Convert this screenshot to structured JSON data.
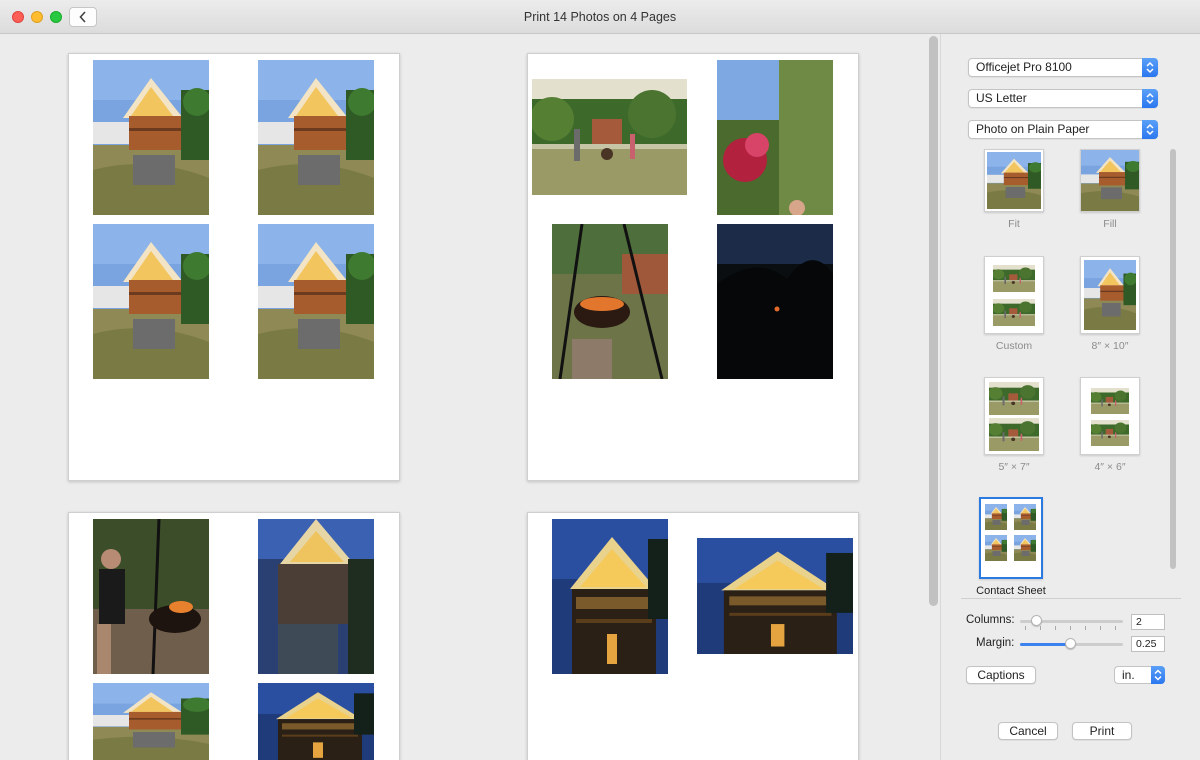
{
  "window": {
    "title": "Print 14 Photos on 4 Pages"
  },
  "settings": {
    "printer": "Officejet Pro 8100",
    "paper_size": "US Letter",
    "paper_type": "Photo on Plain Paper"
  },
  "layouts": [
    {
      "label": "Fit",
      "selected": false
    },
    {
      "label": "Fill",
      "selected": false
    },
    {
      "label": "Custom",
      "selected": false
    },
    {
      "label": "8″ × 10″",
      "selected": false
    },
    {
      "label": "5″ × 7″",
      "selected": false
    },
    {
      "label": "4″ × 6″",
      "selected": false
    },
    {
      "label": "Contact Sheet",
      "selected": true
    }
  ],
  "controls": {
    "columns_label": "Columns:",
    "columns_value": "2",
    "margin_label": "Margin:",
    "margin_value": "0.25",
    "captions_label": "Captions",
    "units_value": "in.",
    "cancel_label": "Cancel",
    "print_label": "Print"
  },
  "colors": {
    "accent": "#2b77ef",
    "sky_day": "#6f9fe0",
    "sky_night": "#1f3a78",
    "house": "#a45a2e",
    "grass": "#8e8a55"
  }
}
